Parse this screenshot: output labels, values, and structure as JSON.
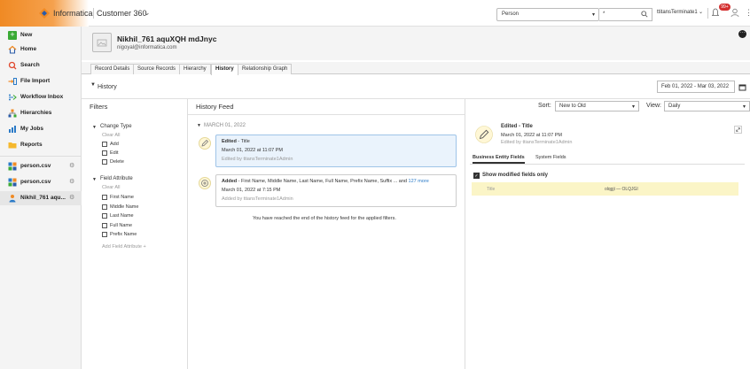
{
  "topbar": {
    "brand": "Informatica",
    "app": "Customer 360",
    "entity": "Person",
    "search_value": "*",
    "user": "ttitansTerminate1",
    "notification_count": "99+",
    "colors": {
      "brand": "#f08a24",
      "badge": "#d32f2f"
    }
  },
  "nav": {
    "items": [
      {
        "label": "New",
        "icon": "plus-icon"
      },
      {
        "label": "Home",
        "icon": "home-icon"
      },
      {
        "label": "Search",
        "icon": "search-icon"
      },
      {
        "label": "File Import",
        "icon": "file-import-icon"
      },
      {
        "label": "Workflow Inbox",
        "icon": "workflow-icon"
      },
      {
        "label": "Hierarchies",
        "icon": "hierarchy-icon"
      },
      {
        "label": "My Jobs",
        "icon": "jobs-icon"
      },
      {
        "label": "Reports",
        "icon": "folder-icon"
      }
    ],
    "recent": [
      {
        "label": "person.csv"
      },
      {
        "label": "person.csv"
      },
      {
        "label": "Nikhil_761 aqu..."
      }
    ]
  },
  "record": {
    "name": "Nikhil_761 aquXQH mdJnyc",
    "email": "nigoyal@informatica.com"
  },
  "tabs": [
    "Record Details",
    "Source Records",
    "Hierarchy",
    "History",
    "Relationship Graph"
  ],
  "history": {
    "title": "History",
    "date_range": "Feb 01, 2022 - Mar 03, 2022"
  },
  "filters": {
    "title": "Filters",
    "change_type": {
      "label": "Change Type",
      "clear": "Clear All",
      "options": [
        "Add",
        "Edit",
        "Delete"
      ]
    },
    "field_attribute": {
      "label": "Field Attribute",
      "clear": "Clear All",
      "options": [
        "First Name",
        "Middle Name",
        "Last Name",
        "Full Name",
        "Prefix Name"
      ]
    },
    "add_field": "Add Field Attribute +"
  },
  "feed": {
    "title": "History Feed",
    "date_group": "MARCH 01, 2022",
    "entries": [
      {
        "action": "Edited",
        "detail": " - Title",
        "date": "March 01, 2022 at 11:07 PM",
        "by": "Edited by ttiansTerminate1Admin"
      },
      {
        "action": "Added",
        "detail": " - First Name, Middle Name, Last Name, Full Name, Prefix Name, Suffix ...  and ",
        "more": "127 more",
        "date": "March 01, 2022 at 7:15 PM",
        "by": "Added by ttiansTerminate1Admin"
      }
    ],
    "end_message": "You have reached the end of the history feed for the applied filters."
  },
  "controls": {
    "sort_label": "Sort:",
    "sort_value": "New to Old",
    "view_label": "View:",
    "view_value": "Daily"
  },
  "detail": {
    "title": "Edited - Title",
    "date": "March 01, 2022 at 11:07 PM",
    "by": "Edited by ttiansTerminate1Admin",
    "tabs": [
      "Business Entity Fields",
      "System Fields"
    ],
    "show_modified": "Show modified fields only",
    "field": {
      "name": "Title",
      "value": "olqgji — OLQJGI"
    }
  }
}
